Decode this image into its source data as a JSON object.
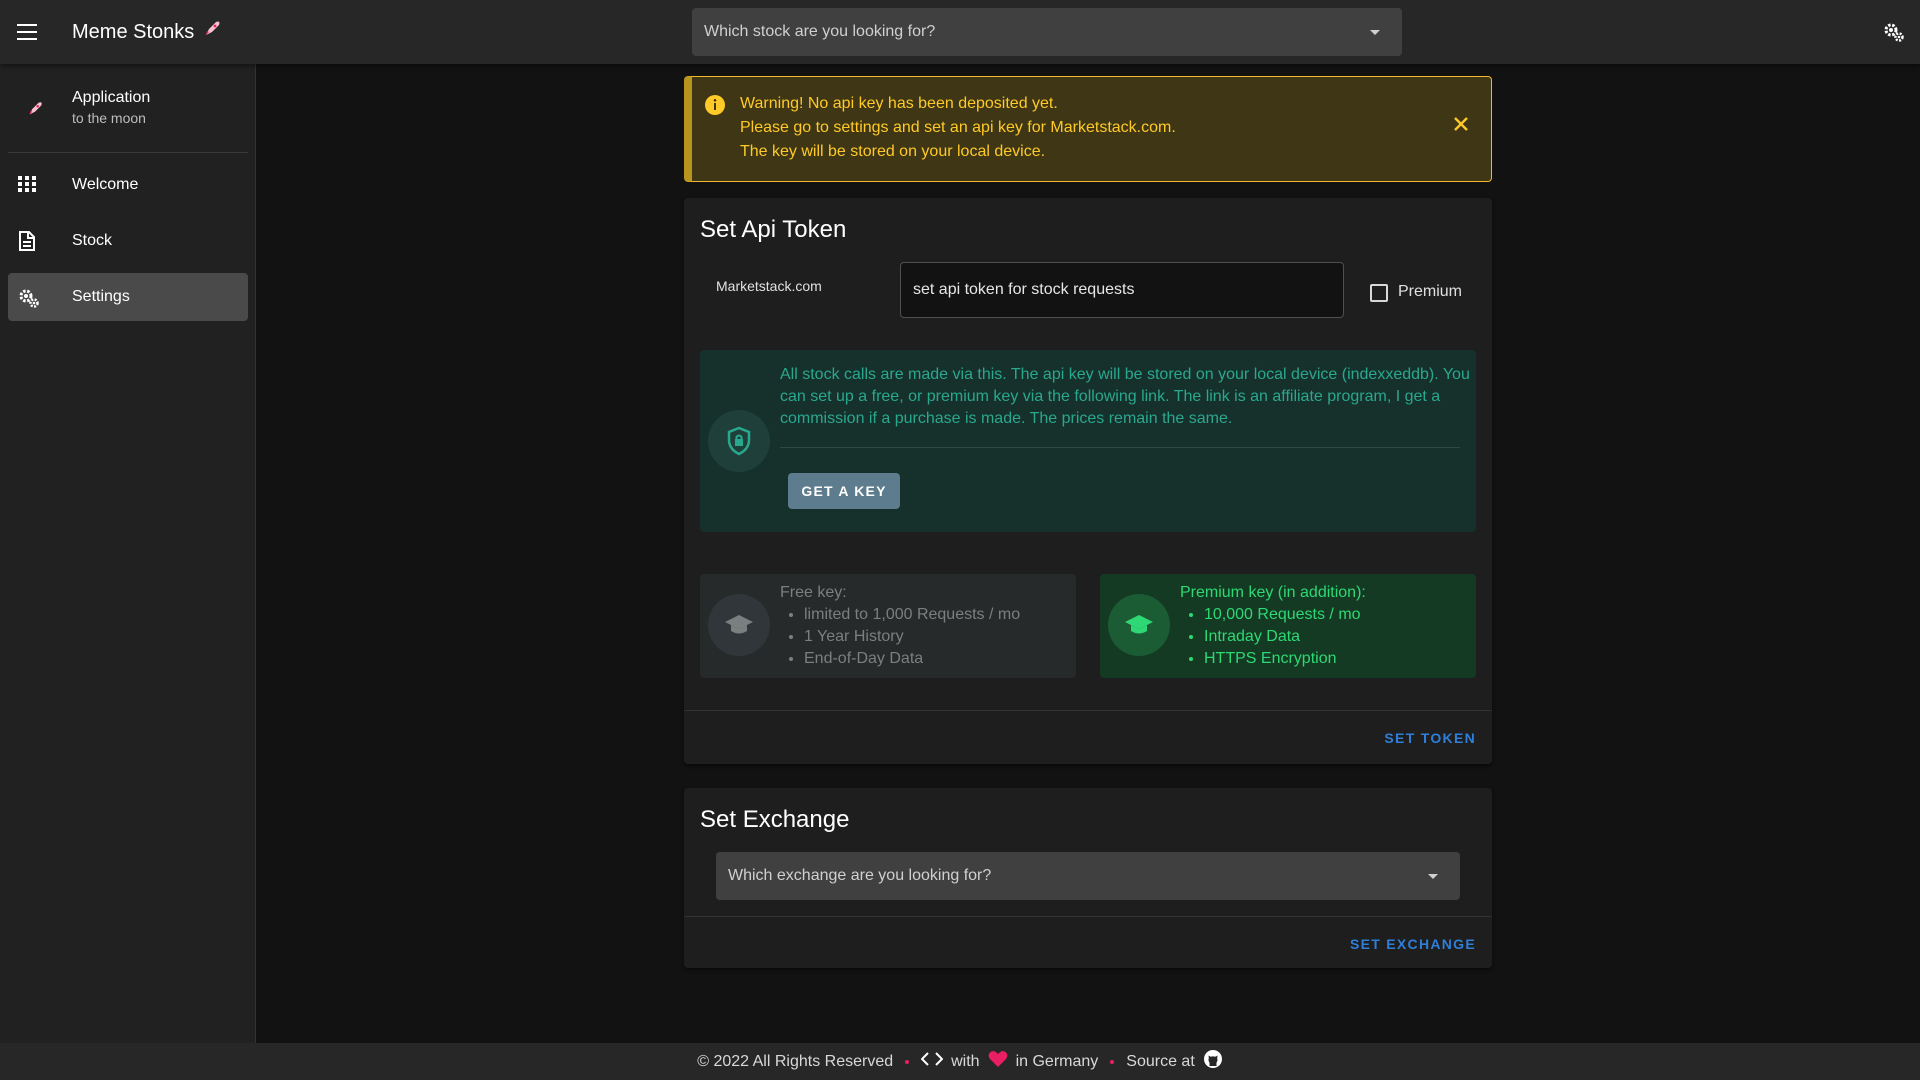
{
  "appbar": {
    "title": "Meme Stonks",
    "title_icon": "rocket-icon",
    "stock_search_placeholder": "Which stock are you looking for?"
  },
  "sidebar": {
    "header": {
      "title": "Application",
      "subtitle": "to the moon",
      "icon": "rocket-icon"
    },
    "items": [
      {
        "label": "Welcome",
        "icon": "apps-grid-icon",
        "active": false
      },
      {
        "label": "Stock",
        "icon": "document-icon",
        "active": false
      },
      {
        "label": "Settings",
        "icon": "gears-icon",
        "active": true
      }
    ]
  },
  "alert": {
    "lines": [
      "Warning! No api key has been deposited yet.",
      "Please go to settings and set an api key for Marketstack.com.",
      "The key will be stored on your local device."
    ],
    "color": "#ffca28"
  },
  "token_card": {
    "title": "Set Api Token",
    "provider_label": "Marketstack.com",
    "input_placeholder": "set api token for stock requests",
    "premium_label": "Premium",
    "premium_checked": false,
    "info_text": "All stock calls are made via this. The api key will be stored on your local device (indexxeddb). You can set up a free, or premium key via the following link. The link is an affiliate program, I get a commission if a purchase is made. The prices remain the same.",
    "get_key_label": "GET A KEY",
    "free_key": {
      "title": "Free key:",
      "items": [
        "limited to 1,000 Requests / mo",
        "1 Year History",
        "End-of-Day Data"
      ]
    },
    "premium_key": {
      "title": "Premium key (in addition):",
      "items": [
        "10,000 Requests / mo",
        "Intraday Data",
        "HTTPS Encryption"
      ]
    },
    "action_label": "SET TOKEN"
  },
  "exchange_card": {
    "title": "Set Exchange",
    "select_placeholder": "Which exchange are you looking for?",
    "action_label": "SET EXCHANGE"
  },
  "footer": {
    "copyright": "© 2022 All Rights Reserved",
    "made_with": "with",
    "made_in": "in Germany",
    "source": "Source at"
  },
  "colors": {
    "accent": "#2f7ed8",
    "warning": "#ffca28",
    "info_teal": "#2aa88e",
    "premium_green": "#2ed874",
    "heart": "#e91e63"
  }
}
